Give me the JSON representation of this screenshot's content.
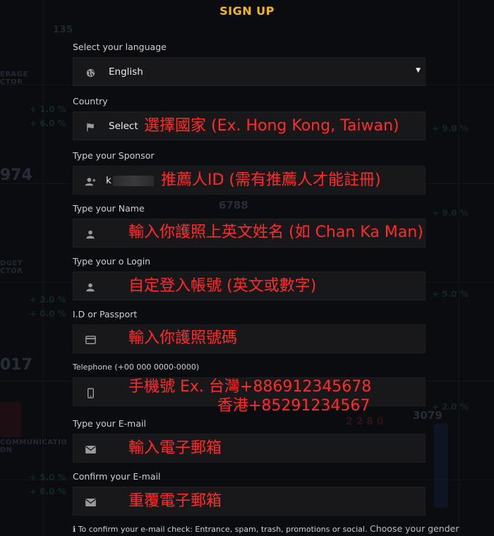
{
  "title": "SIGN UP",
  "colors": {
    "accent": "#f3b81a",
    "annotation": "#ff2a2a"
  },
  "fields": [
    {
      "label": "Select your language",
      "icon": "globe-icon",
      "value": "English",
      "dropdown": true,
      "annotation": ""
    },
    {
      "label": "Country",
      "icon": "flag-icon",
      "value": "Select",
      "annotation": "選擇國家 (Ex. Hong Kong, Taiwan)"
    },
    {
      "label": "Type your Sponsor",
      "icon": "user-plus-icon",
      "value": "k",
      "redacted": true,
      "annotation": "推薦人ID (需有推薦人才能註冊)"
    },
    {
      "label": "Type your Name",
      "icon": "user-icon",
      "value": "",
      "annotation": "輸入你護照上英文姓名 (如 Chan Ka Man)"
    },
    {
      "label": "Type your o Login",
      "icon": "user-icon",
      "value": "",
      "annotation": "自定登入帳號 (英文或數字)"
    },
    {
      "label": "I.D or Passport",
      "icon": "id-card-icon",
      "value": "",
      "annotation": "輸入你護照號碼"
    },
    {
      "label": "Telephone (+00 000 0000-0000)",
      "icon": "mobile-phone-icon",
      "value": "",
      "annotation": "手機號 Ex. 台灣+886912345678",
      "annotation_line2": "香港+85291234567"
    },
    {
      "label": "Type your E-mail",
      "icon": "envelope-icon",
      "value": "",
      "annotation": "輸入電子郵箱"
    },
    {
      "label": "Confirm your E-mail",
      "icon": "envelope-icon",
      "value": "",
      "annotation": "重覆電子郵箱"
    }
  ],
  "note": {
    "icon": "info-icon",
    "text": "To confirm your e-mail check: Entrance, spam, trash, promotions or social.",
    "gender_label": "Choose your gender"
  }
}
